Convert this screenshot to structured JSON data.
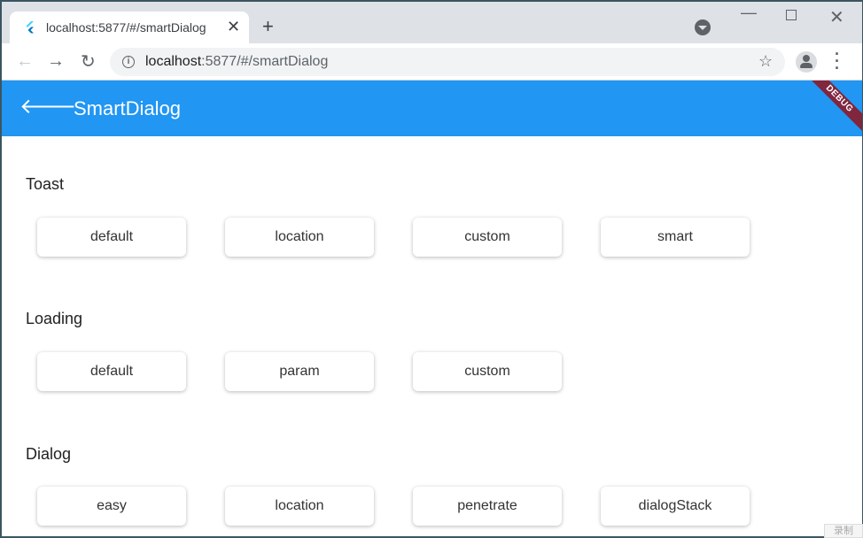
{
  "browser": {
    "tab": {
      "title": "localhost:5877/#/smartDialog",
      "close": "✕"
    },
    "new_tab": "+",
    "address": {
      "host": "localhost",
      "path": ":5877/#/smartDialog",
      "info": "i"
    }
  },
  "app": {
    "title": "SmartDialog",
    "debug_banner": "DEBUG",
    "accent_color": "#2196f3"
  },
  "sections": [
    {
      "title": "Toast",
      "buttons": [
        "default",
        "location",
        "custom",
        "smart"
      ]
    },
    {
      "title": "Loading",
      "buttons": [
        "default",
        "param",
        "custom"
      ]
    },
    {
      "title": "Dialog",
      "buttons": [
        "easy",
        "location",
        "penetrate",
        "dialogStack"
      ]
    }
  ],
  "overlay": {
    "corner_text": "录制"
  }
}
